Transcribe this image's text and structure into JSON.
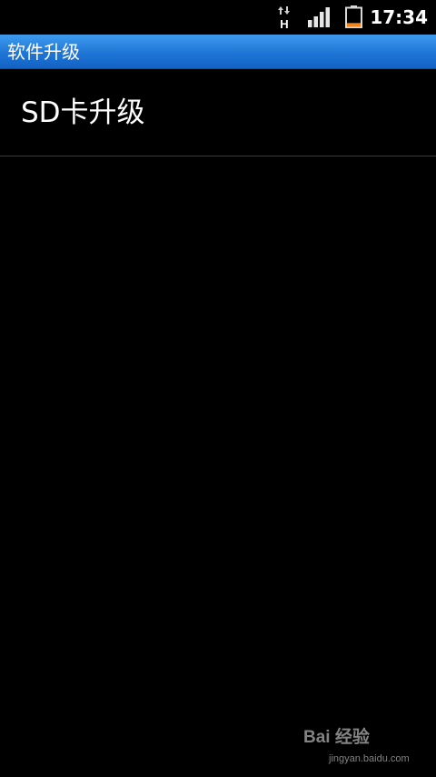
{
  "status_bar": {
    "network_type": "H",
    "time": "17:34",
    "icons": [
      "data-transfer-arrows-icon",
      "signal-strength-icon",
      "battery-icon"
    ],
    "battery_level": 0.2,
    "battery_color": "#f0851e"
  },
  "title_bar": {
    "title": "软件升级",
    "color": "#1f76d6"
  },
  "list": {
    "items": [
      {
        "label": "SD卡升级"
      }
    ]
  },
  "watermark": {
    "logo_text": "Bai 经验",
    "url": "jingyan.baidu.com"
  }
}
